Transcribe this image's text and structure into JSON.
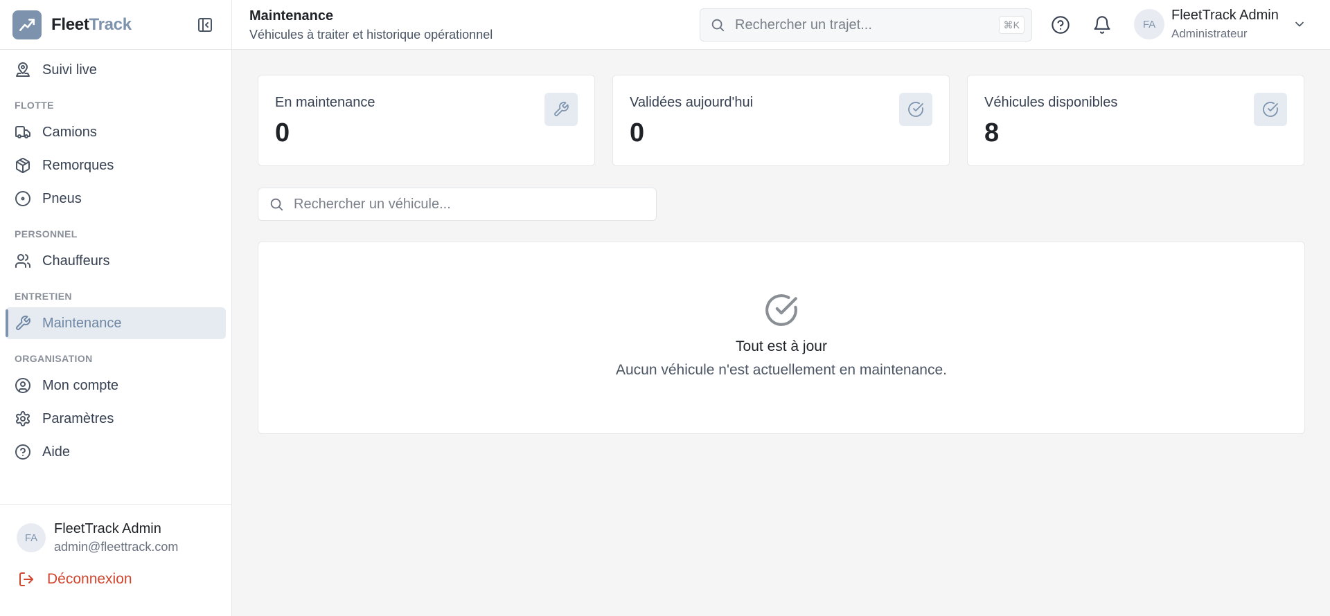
{
  "app": {
    "name_part1": "Fleet",
    "name_part2": "Track",
    "accent_color": "#7d93ad",
    "danger_color": "#d0452e"
  },
  "sidebar": {
    "items": [
      {
        "label": "Suivi live",
        "icon": "map-pin-user-icon"
      },
      {
        "label": "Camions",
        "icon": "truck-icon"
      },
      {
        "label": "Remorques",
        "icon": "package-icon"
      },
      {
        "label": "Pneus",
        "icon": "tire-icon"
      },
      {
        "label": "Chauffeurs",
        "icon": "users-icon"
      },
      {
        "label": "Maintenance",
        "icon": "wrench-icon",
        "active": true
      },
      {
        "label": "Mon compte",
        "icon": "user-circle-icon"
      },
      {
        "label": "Paramètres",
        "icon": "gear-icon"
      },
      {
        "label": "Aide",
        "icon": "help-circle-icon"
      }
    ],
    "sections": {
      "flotte": "FLOTTE",
      "personnel": "PERSONNEL",
      "entretien": "ENTRETIEN",
      "organisation": "ORGANISATION"
    },
    "user": {
      "initials": "FA",
      "name": "FleetTrack Admin",
      "email": "admin@fleettrack.com"
    },
    "logout_label": "Déconnexion"
  },
  "header": {
    "title": "Maintenance",
    "subtitle": "Véhicules à traiter et historique opérationnel",
    "search_placeholder": "Rechercher un trajet...",
    "search_shortcut": "⌘K",
    "user": {
      "initials": "FA",
      "name": "FleetTrack Admin",
      "role": "Administrateur"
    }
  },
  "stats": [
    {
      "label": "En maintenance",
      "value": "0",
      "icon": "wrench-icon"
    },
    {
      "label": "Validées aujourd'hui",
      "value": "0",
      "icon": "check-circle-icon"
    },
    {
      "label": "Véhicules disponibles",
      "value": "8",
      "icon": "check-circle-icon"
    }
  ],
  "vehicle_search": {
    "placeholder": "Rechercher un véhicule..."
  },
  "empty_state": {
    "title": "Tout est à jour",
    "description": "Aucun véhicule n'est actuellement en maintenance."
  }
}
